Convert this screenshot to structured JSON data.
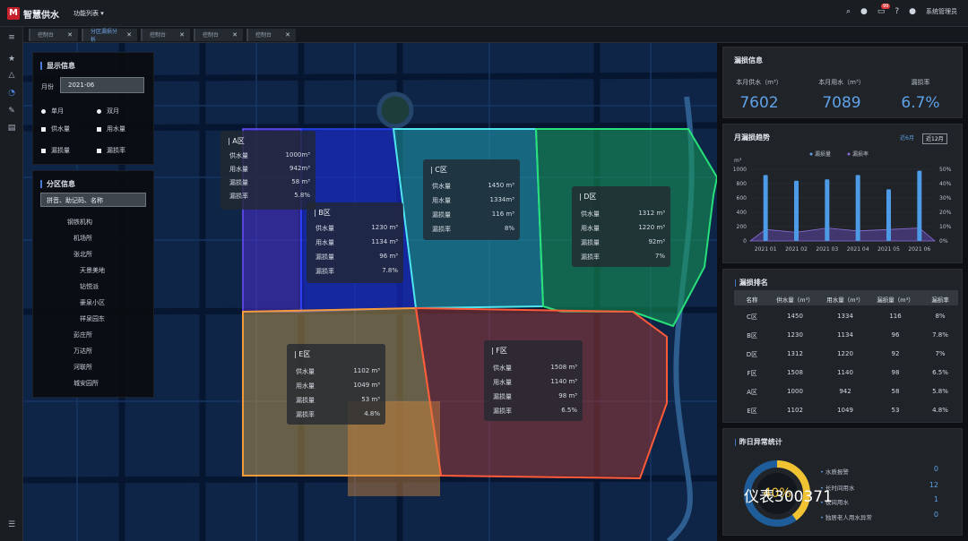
{
  "app": {
    "logo_text": "M",
    "title": "智慧供水",
    "func_menu": "功能列表 ▾",
    "user": "系统管理员",
    "message_badge": "99"
  },
  "tabs": [
    {
      "label": "控制台",
      "active": false
    },
    {
      "label": "分区漏损分析",
      "active": true
    },
    {
      "label": "控制台",
      "active": false
    },
    {
      "label": "控制台",
      "active": false
    },
    {
      "label": "控制台",
      "active": false
    }
  ],
  "display_info": {
    "title": "显示信息",
    "month_label": "月份",
    "month_value": "2021-06",
    "radios": [
      "单月",
      "双月"
    ],
    "checks": [
      "供水量",
      "用水量",
      "漏损量",
      "漏损率"
    ]
  },
  "partition_info": {
    "title": "分区信息",
    "search_placeholder": "拼音、助记码、名称",
    "items": [
      "钢铁机构",
      "机场所",
      "张北所",
      "天景美地",
      "钻悦派",
      "豪泉小区",
      "祥泉园东",
      "彭庄所",
      "万达所",
      "河联所",
      "城安园所"
    ]
  },
  "zones": [
    {
      "name": "A区",
      "supply": "1000m³",
      "use": "942m³",
      "loss": "58 m³",
      "rate": "5.8%"
    },
    {
      "name": "B区",
      "supply": "1230 m³",
      "use": "1134 m³",
      "loss": "96 m³",
      "rate": "7.8%"
    },
    {
      "name": "C区",
      "supply": "1450 m³",
      "use": "1334m³",
      "loss": "116 m³",
      "rate": "8%"
    },
    {
      "name": "D区",
      "supply": "1312 m³",
      "use": "1220 m³",
      "loss": "92m³",
      "rate": "7%"
    },
    {
      "name": "E区",
      "supply": "1102 m³",
      "use": "1049 m³",
      "loss": "53 m³",
      "rate": "4.8%"
    },
    {
      "name": "F区",
      "supply": "1508 m³",
      "use": "1140 m³",
      "loss": "98 m³",
      "rate": "6.5%"
    }
  ],
  "zone_labels": {
    "supply": "供水量",
    "use": "用水量",
    "loss": "漏损量",
    "rate": "漏损率"
  },
  "loss_info": {
    "title": "漏损信息",
    "supply_label": "本月供水（m³）",
    "supply_value": "7602",
    "use_label": "本月用水（m³）",
    "use_value": "7089",
    "rate_label": "漏损率",
    "rate_value": "6.7%"
  },
  "trend": {
    "title": "月漏损趋势",
    "btn_6m": "近6月",
    "btn_12m": "近12月",
    "legend_loss": "漏损量",
    "legend_rate": "漏损率"
  },
  "chart_data": {
    "type": "bar",
    "categories": [
      "2021 01",
      "2021 02",
      "2021 03",
      "2021 04",
      "2021 05",
      "2021 06"
    ],
    "series": [
      {
        "name": "漏损量",
        "type": "bar",
        "values": [
          920,
          840,
          860,
          920,
          720,
          980
        ]
      },
      {
        "name": "漏损率",
        "type": "area",
        "values": [
          8,
          6,
          9,
          7,
          8,
          9
        ]
      }
    ],
    "ylabel": "m³",
    "ylim": [
      0,
      1000
    ],
    "y_ticks": [
      "0",
      "200",
      "400",
      "600",
      "800",
      "1000"
    ],
    "y2lim": [
      0,
      50
    ],
    "y2_ticks": [
      "0%",
      "10%",
      "20%",
      "30%",
      "40%",
      "50%"
    ]
  },
  "ranking": {
    "title": "漏损排名",
    "headers": [
      "名称",
      "供水量（m³）",
      "用水量（m³）",
      "漏损量（m³）",
      "漏损率"
    ],
    "rows": [
      [
        "C区",
        "1450",
        "1334",
        "116",
        "8%"
      ],
      [
        "B区",
        "1230",
        "1134",
        "96",
        "7.8%"
      ],
      [
        "D区",
        "1312",
        "1220",
        "92",
        "7%"
      ],
      [
        "F区",
        "1508",
        "1140",
        "98",
        "6.5%"
      ],
      [
        "A区",
        "1000",
        "942",
        "58",
        "5.8%"
      ],
      [
        "E区",
        "1102",
        "1049",
        "53",
        "4.8%"
      ]
    ]
  },
  "abnormal": {
    "title": "昨日异常统计",
    "ring_value": "40%",
    "items": [
      {
        "label": "水质报警",
        "value": "0"
      },
      {
        "label": "长时间用水",
        "value": "12"
      },
      {
        "label": "夜间用水",
        "value": "1"
      },
      {
        "label": "独居老人用水异常",
        "value": "0"
      }
    ]
  },
  "watermark": "仪表300371"
}
